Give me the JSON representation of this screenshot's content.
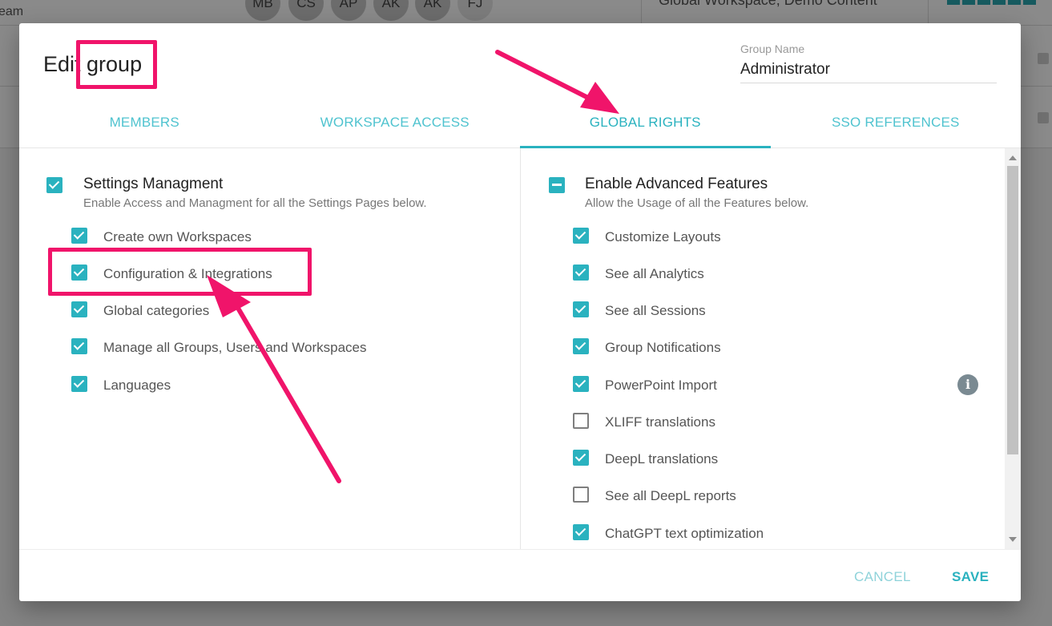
{
  "background": {
    "team_label": "eam",
    "avatars": [
      "MB",
      "CS",
      "AP",
      "AK",
      "AK",
      "FJ"
    ],
    "workspace_label": "Global Workspace, Demo Content"
  },
  "dialog": {
    "title": "Edit group",
    "group_name": {
      "label": "Group Name",
      "value": "Administrator"
    },
    "tabs": [
      {
        "label": "MEMBERS",
        "active": false
      },
      {
        "label": "WORKSPACE ACCESS",
        "active": false
      },
      {
        "label": "GLOBAL RIGHTS",
        "active": true
      },
      {
        "label": "SSO REFERENCES",
        "active": false
      }
    ],
    "settings": {
      "title": "Settings Managment",
      "description": "Enable Access and Managment for all the Settings Pages below.",
      "state": "checked",
      "items": [
        {
          "label": "Create own Workspaces",
          "checked": true
        },
        {
          "label": "Configuration & Integrations",
          "checked": true
        },
        {
          "label": "Global categories",
          "checked": true
        },
        {
          "label": "Manage all Groups, Users and Workspaces",
          "checked": true
        },
        {
          "label": "Languages",
          "checked": true
        }
      ]
    },
    "features": {
      "title": "Enable Advanced Features",
      "description": "Allow the Usage of all the Features below.",
      "state": "indeterminate",
      "items": [
        {
          "label": "Customize Layouts",
          "checked": true
        },
        {
          "label": "See all Analytics",
          "checked": true
        },
        {
          "label": "See all Sessions",
          "checked": true
        },
        {
          "label": "Group Notifications",
          "checked": true
        },
        {
          "label": "PowerPoint Import",
          "checked": true,
          "info_icon": "info-icon"
        },
        {
          "label": "XLIFF translations",
          "checked": false
        },
        {
          "label": "DeepL translations",
          "checked": true
        },
        {
          "label": "See all DeepL reports",
          "checked": false
        },
        {
          "label": "ChatGPT text optimization",
          "checked": true
        }
      ]
    },
    "footer": {
      "cancel_label": "CANCEL",
      "save_label": "SAVE"
    }
  },
  "colors": {
    "accent": "#2ab2bf",
    "tab_text": "#4fc3cf",
    "annotation": "#f0146a"
  }
}
